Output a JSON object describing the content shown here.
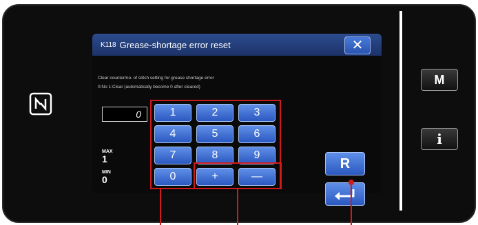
{
  "dialog": {
    "code": "K118",
    "title": "Grease-shortage error reset",
    "close_label": "✕",
    "description_line1": "Clear counter/no. of stitch setting for grease shortage error",
    "description_line2": "0:No 1:Clear (automatically become 0 after cleared)",
    "current_value": "0",
    "max_label": "MAX",
    "max_value": "1",
    "min_label": "MIN",
    "min_value": "0"
  },
  "keypad": {
    "keys": [
      "1",
      "2",
      "3",
      "4",
      "5",
      "6",
      "7",
      "8",
      "9",
      "0",
      "+",
      "—"
    ]
  },
  "buttons": {
    "reset_label": "R",
    "menu_label": "M",
    "info_label": "i"
  },
  "colors": {
    "accent": "#2b58c0",
    "highlight": "#d11a1a"
  }
}
